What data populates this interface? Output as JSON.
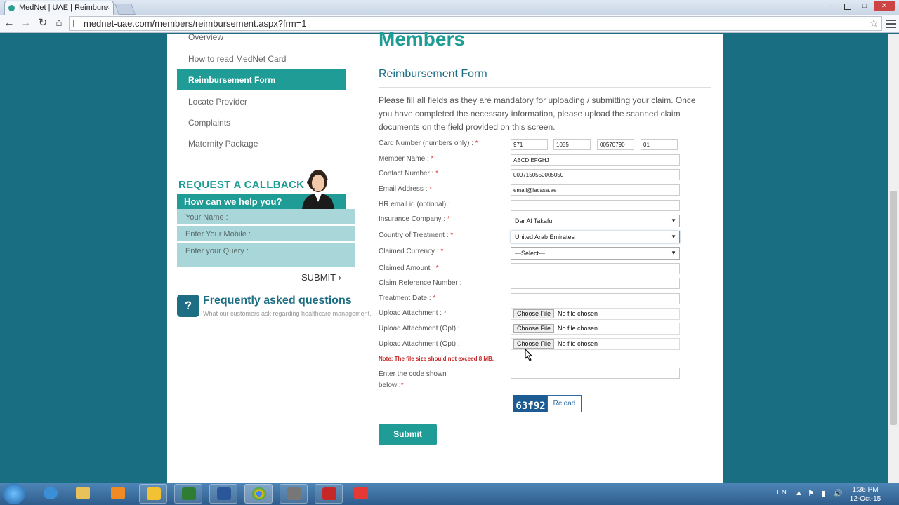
{
  "browser": {
    "tab_title": "MedNet | UAE | Reimburs",
    "tab_close": "×",
    "url": "mednet-uae.com/members/reimbursement.aspx?frm=1",
    "window_controls": {
      "minimize": "–",
      "maximize": "□",
      "close": "✕"
    },
    "nav": {
      "back": "←",
      "forward": "→",
      "reload": "↻",
      "home": "⌂"
    }
  },
  "sidebar": {
    "items": [
      {
        "label": "Overview"
      },
      {
        "label": "How to read MedNet Card"
      },
      {
        "label": "Reimbursement Form"
      },
      {
        "label": "Locate Provider"
      },
      {
        "label": "Complaints"
      },
      {
        "label": "Maternity Package"
      }
    ],
    "active_index": 2
  },
  "callback": {
    "title": "REQUEST A CALLBACK",
    "subtitle": "How can we help you?",
    "name_placeholder": "Your Name :",
    "mobile_placeholder": "Enter Your Mobile :",
    "query_placeholder": "Enter your Query :",
    "submit_label": "SUBMIT",
    "submit_arrow": "›"
  },
  "faq": {
    "icon": "?",
    "title": "Frequently asked questions",
    "subtitle": "What our customers ask regarding healthcare management."
  },
  "main": {
    "heading": "Members",
    "form_title": "Reimbursement Form",
    "intro": "Please fill all fields as they are mandatory for uploading / submitting your claim. Once you have completed the necessary information, please upload the scanned claim documents on the field provided on this screen."
  },
  "form": {
    "required_mark": "*",
    "card_number": {
      "label": "Card Number (numbers only) :",
      "values": [
        "971",
        "1035",
        "00570790",
        "01"
      ]
    },
    "member_name": {
      "label": "Member Name :",
      "value": "ABCD EFGHJ"
    },
    "contact_number": {
      "label": "Contact Number :",
      "value": "0097150550005050"
    },
    "email": {
      "label": "Email Address :",
      "value": "email@lacasa.ae"
    },
    "hr_email": {
      "label": "HR email id (optional) :",
      "value": ""
    },
    "insurance_company": {
      "label": "Insurance Company :",
      "value": "Dar Al Takaful"
    },
    "country": {
      "label": "Country of Treatment :",
      "value": "United Arab Emirates"
    },
    "currency": {
      "label": "Claimed Currency :",
      "value": "---Select---"
    },
    "amount": {
      "label": "Claimed Amount :",
      "value": ""
    },
    "claim_ref": {
      "label": "Claim Reference Number :",
      "value": ""
    },
    "treatment_date": {
      "label": "Treatment Date :",
      "value": ""
    },
    "upload1": {
      "label": "Upload Attachment :",
      "button": "Choose File",
      "status": "No file chosen"
    },
    "upload2": {
      "label": "Upload Attachment (Opt) :",
      "button": "Choose File",
      "status": "No file chosen"
    },
    "upload3": {
      "label": "Upload Attachment (Opt) :",
      "button": "Choose File",
      "status": "No file chosen"
    },
    "note": "Note: The file size should not exceed 8 MB.",
    "captcha_label_line1": "Enter the code shown",
    "captcha_label_line2": "below :",
    "captcha_code": "63f92",
    "captcha_reload": "Reload",
    "submit": "Submit",
    "select_arrow": "▼"
  },
  "taskbar": {
    "language": "EN",
    "time": "1:36 PM",
    "date": "12-Oct-15",
    "tray_icons": [
      "▲",
      "⚑",
      "▮",
      "🔊"
    ]
  },
  "colors": {
    "accent": "#1f9c95",
    "background": "#1a6e82",
    "faq": "#1d6e84",
    "required": "#e13a3a"
  }
}
